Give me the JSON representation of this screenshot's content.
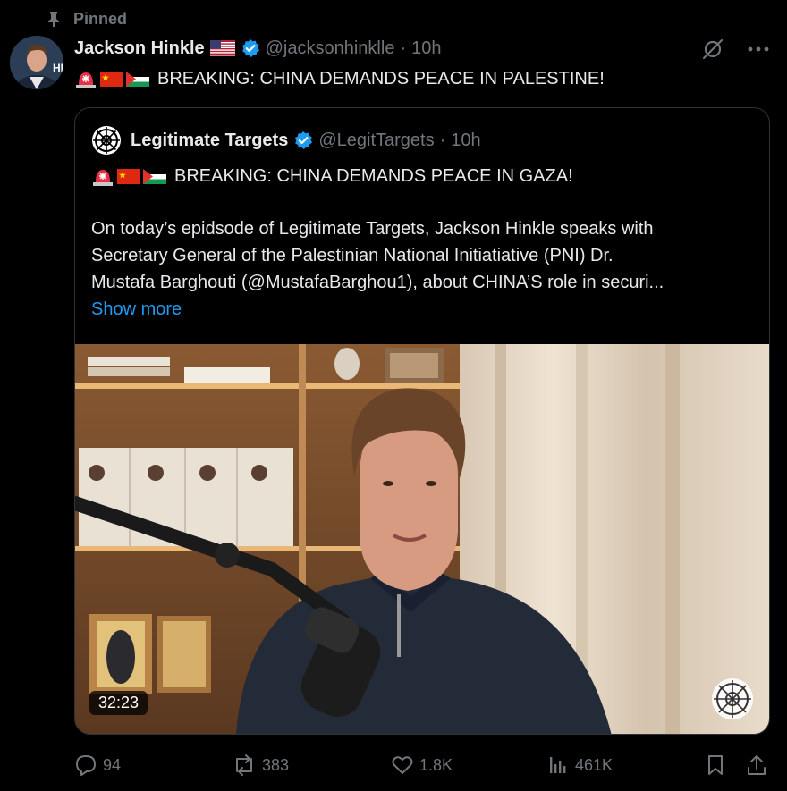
{
  "pinned": {
    "label": "Pinned",
    "icon": "pin-icon"
  },
  "tweet": {
    "author": {
      "name": "Jackson Hinkle",
      "handle": "@jacksonhinklle",
      "time_sep": "·",
      "time": "10h",
      "flag": "us-flag",
      "verified": true
    },
    "text": "BREAKING: CHINA DEMANDS PEACE IN PALESTINE!",
    "emojis": [
      "rotating-light-emoji",
      "china-flag",
      "palestine-flag"
    ]
  },
  "quote": {
    "author": {
      "name": "Legitimate Targets",
      "handle": "@LegitTargets",
      "time_sep": "·",
      "time": "10h",
      "verified": true
    },
    "headline": "BREAKING: CHINA DEMANDS PEACE IN GAZA!",
    "emojis": [
      "rotating-light-emoji",
      "china-flag",
      "palestine-flag"
    ],
    "body_lines": [
      "On today’s epidsode of Legitimate Targets, Jackson Hinkle speaks with",
      "Secretary General of the Palestinian National Initiatiative (PNI) Dr.",
      "Mustafa Barghouti (@MustafaBarghou1), about CHINA’S role in securi..."
    ],
    "show_more": "Show more",
    "video": {
      "duration": "32:23"
    }
  },
  "actions": {
    "replies": "94",
    "reposts": "383",
    "likes": "1.8K",
    "views": "461K"
  },
  "colors": {
    "background": "#000000",
    "text": "#e7e9ea",
    "muted": "#71767b",
    "accent": "#1d9bf0",
    "border": "#2f3336"
  }
}
